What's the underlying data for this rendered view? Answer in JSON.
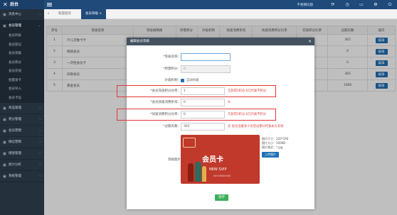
{
  "app": {
    "logo_text": "后台"
  },
  "topbar": {
    "right_text": "不想拥问题"
  },
  "sidebar": {
    "items": [
      {
        "label": "消息中心",
        "icon": "home-icon"
      },
      {
        "label": "会员管理",
        "icon": "users-icon"
      }
    ],
    "sub_items": [
      "会员列表",
      "会员登记",
      "会员等级",
      "会员积分",
      "会员充值",
      "批量发卡",
      "会员导入",
      "会员卡设"
    ],
    "bottom_items": [
      {
        "label": "商品管理",
        "icon": "box-icon"
      },
      {
        "label": "积分管理",
        "icon": "star-icon"
      },
      {
        "label": "会员营销",
        "icon": "gift-icon"
      },
      {
        "label": "微信营销",
        "icon": "wechat-icon"
      },
      {
        "label": "储值管理",
        "icon": "wallet-icon"
      },
      {
        "label": "统计分析",
        "icon": "chart-icon"
      },
      {
        "label": "系统管理",
        "icon": "gear-icon"
      }
    ]
  },
  "tabs": {
    "home": "欢迎首页",
    "current": "会员等级 ×"
  },
  "table": {
    "headers": [
      "序号",
      "等级名称",
      "等级缩略图",
      "所需积分",
      "升级机制",
      "快速消费折扣",
      "快速消费积分比率",
      "充值积分比率",
      "过期天数",
      "操作"
    ],
    "rows": [
      {
        "no": "1",
        "name": "介儿次数卡卡",
        "days": "365",
        "edit": "编辑"
      },
      {
        "no": "2",
        "name": "储值会员",
        "days": "0",
        "edit": "编辑"
      },
      {
        "no": "3",
        "name": "一次性会员卡",
        "days": "0",
        "edit": "编辑"
      },
      {
        "no": "4",
        "name": "白银会员",
        "rate": "10",
        "days": "365",
        "edit": "编辑"
      },
      {
        "no": "5",
        "name": "黄金会员",
        "rate": "10",
        "days": "1000",
        "edit": "编辑"
      }
    ]
  },
  "modal": {
    "title": "编辑会员等级",
    "fields": {
      "name_label": "*等级名称：",
      "name_value": "",
      "points_label": "*所需积分：",
      "points_value": "0",
      "upgrade_label": "升级机制：",
      "upgrade_value": "自动升级",
      "recharge_label": "*会员充值积分比率：",
      "recharge_value": "1",
      "recharge_note": "元获得1积分,0元代表不积分",
      "discount_label": "*会员快速消费折扣：",
      "discount_value": "0",
      "discount_unit": "%",
      "quick_label": "*快速消费积分比率：",
      "quick_value": "0",
      "quick_note": "元获得1积分,0元代表不积分",
      "expire_label": "*过期天数：",
      "expire_value": "365",
      "expire_note": "天 会员注册多少天后过期,0代表永久有效",
      "image_label": "等级图片"
    },
    "card": {
      "title": "会员卡",
      "subtitle": "NEW SVIP",
      "number": "NO:00000000"
    },
    "image_info": [
      "图片尺寸：320*190",
      "图片大小：200KB",
      "图片格式：*.jpg"
    ],
    "upload_label": "上传图片",
    "save_label": "保存"
  },
  "colors": {
    "topbar": "#1f4a7a",
    "sidebar": "#24303c",
    "accent": "#1f6fb5",
    "alert": "#e03a3a",
    "save": "#3cae5a",
    "card": "#c0392b"
  }
}
